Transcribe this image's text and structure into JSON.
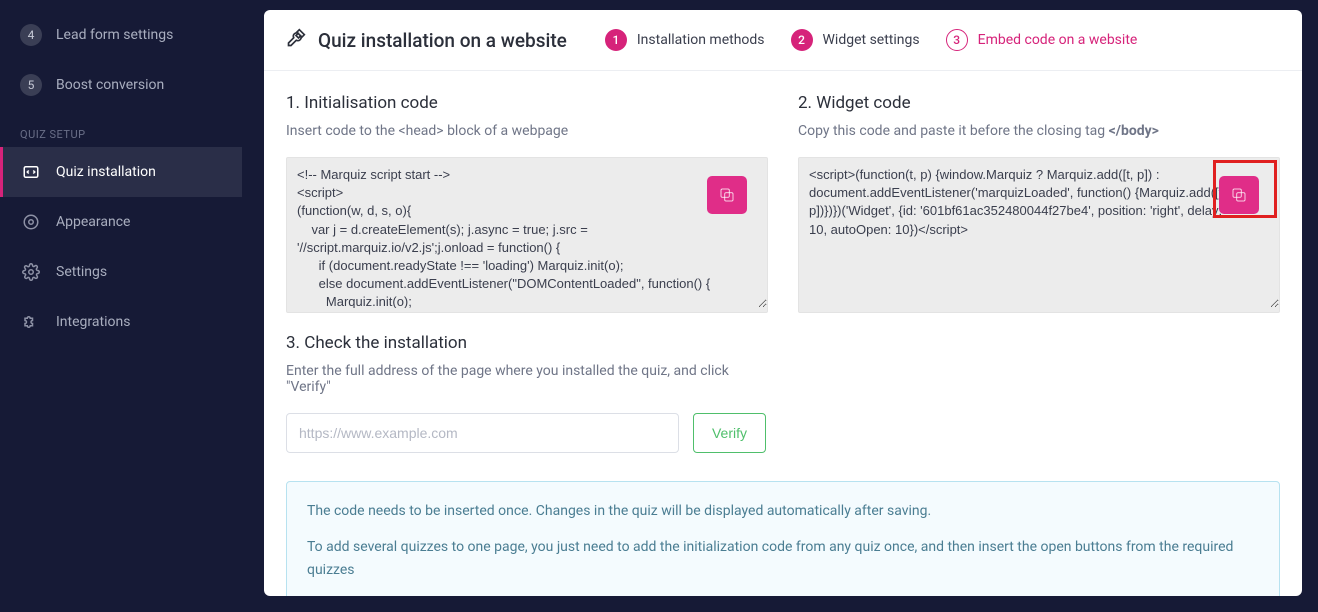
{
  "sidebar": {
    "top_items": [
      {
        "num": "4",
        "label": "Lead form settings"
      },
      {
        "num": "5",
        "label": "Boost conversion"
      }
    ],
    "section_label": "QUIZ SETUP",
    "nav_items": [
      {
        "label": "Quiz installation",
        "active": true
      },
      {
        "label": "Appearance"
      },
      {
        "label": "Settings"
      },
      {
        "label": "Integrations"
      }
    ]
  },
  "header": {
    "title": "Quiz installation on a website",
    "steps": [
      {
        "num": "1",
        "label": "Installation methods",
        "state": "completed"
      },
      {
        "num": "2",
        "label": "Widget settings",
        "state": "completed"
      },
      {
        "num": "3",
        "label": "Embed code on a website",
        "state": "current"
      }
    ]
  },
  "section1": {
    "title": "1. Initialisation code",
    "hint": "Insert code to the <head> block of a webpage",
    "code": "<!-- Marquiz script start -->\n<script>\n(function(w, d, s, o){\n    var j = d.createElement(s); j.async = true; j.src = '//script.marquiz.io/v2.js';j.onload = function() {\n      if (document.readyState !== 'loading') Marquiz.init(o);\n      else document.addEventListener(\"DOMContentLoaded\", function() {\n        Marquiz.init(o);"
  },
  "section2": {
    "title": "2. Widget code",
    "hint_prefix": "Copy this code and paste it before the closing tag ",
    "hint_tag": "</body>",
    "code": "<script>(function(t, p) {window.Marquiz ? Marquiz.add([t, p]) : document.addEventListener('marquizLoaded', function() {Marquiz.add([t, p])})})('Widget', {id: '601bf61ac352480044f27be4', position: 'right', delay: 10, autoOpen: 10})</script>"
  },
  "section3": {
    "title": "3. Check the installation",
    "hint": "Enter the full address of the page where you installed the quiz, and click \"Verify\"",
    "placeholder": "https://www.example.com",
    "verify_label": "Verify"
  },
  "info": {
    "line1": "The code needs to be inserted once. Changes in the quiz will be displayed automatically after saving.",
    "line2": "To add several quizzes to one page, you just need to add the initialization code from any quiz once, and then insert the open buttons from the required quizzes"
  }
}
